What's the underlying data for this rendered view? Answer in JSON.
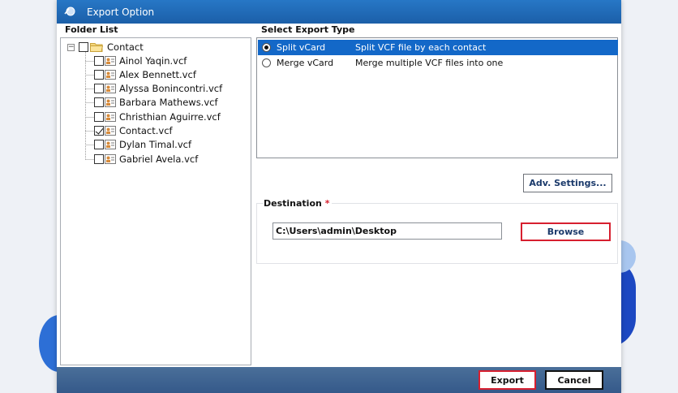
{
  "window": {
    "title": "Export Option"
  },
  "folder_list": {
    "label": "Folder List",
    "root": {
      "name": "Contact",
      "checked": false
    },
    "items": [
      {
        "name": "Ainol Yaqin.vcf",
        "checked": false
      },
      {
        "name": "Alex Bennett.vcf",
        "checked": false
      },
      {
        "name": "Alyssa Bonincontri.vcf",
        "checked": false
      },
      {
        "name": "Barbara Mathews.vcf",
        "checked": false
      },
      {
        "name": "Christhian Aguirre.vcf",
        "checked": false
      },
      {
        "name": "Contact.vcf",
        "checked": true
      },
      {
        "name": "Dylan Timal.vcf",
        "checked": false
      },
      {
        "name": "Gabriel Avela.vcf",
        "checked": false
      }
    ]
  },
  "export_type": {
    "label": "Select Export Type",
    "options": [
      {
        "name": "Split vCard",
        "description": "Split VCF file by each contact",
        "selected": true
      },
      {
        "name": "Merge vCard",
        "description": "Merge multiple VCF files into one",
        "selected": false
      }
    ]
  },
  "adv_settings_label": "Adv. Settings...",
  "destination": {
    "label": "Destination",
    "required_mark": "*",
    "path": "C:\\Users\\admin\\Desktop",
    "browse_label": "Browse"
  },
  "footer": {
    "export_label": "Export",
    "cancel_label": "Cancel"
  },
  "colors": {
    "titlebar": "#1f69b6",
    "selection": "#1368c8",
    "highlight_outline": "#d71f2f",
    "footer": "#3f6591"
  }
}
